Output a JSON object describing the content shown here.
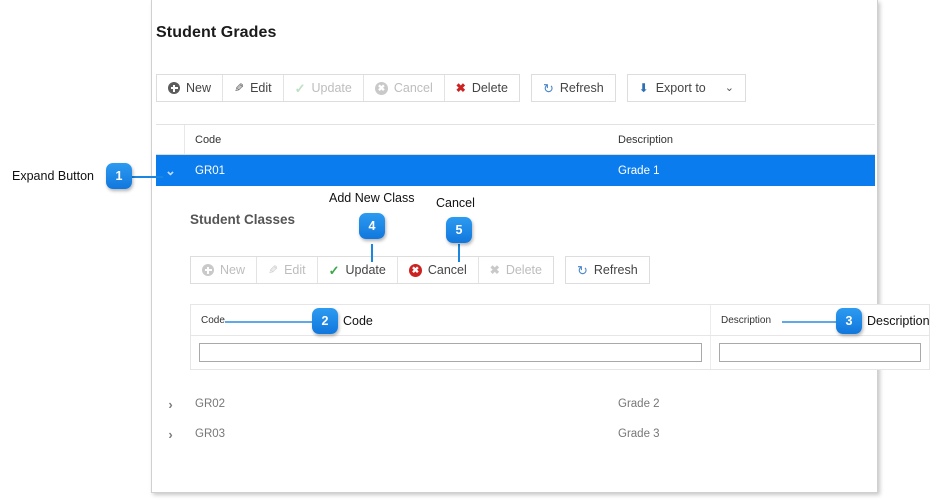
{
  "page": {
    "title": "Student Grades",
    "accent_blue": "#0b7ced",
    "badge_blue": "#1177dd",
    "red": "#cc2222",
    "green": "#3aa84a"
  },
  "main_toolbar": {
    "buttons": [
      {
        "label": "New",
        "icon": "plus-circle-icon",
        "disabled": false
      },
      {
        "label": "Edit",
        "icon": "pencil-icon",
        "disabled": false
      },
      {
        "label": "Update",
        "icon": "check-icon",
        "disabled": true
      },
      {
        "label": "Cancel",
        "icon": "cancel-circle-icon",
        "disabled": true
      },
      {
        "label": "Delete",
        "icon": "x-icon",
        "disabled": false
      }
    ],
    "refresh": {
      "label": "Refresh",
      "icon": "refresh-icon"
    },
    "export": {
      "label": "Export to",
      "icon": "download-icon",
      "caret": "chevron-down-icon"
    }
  },
  "grid": {
    "columns": [
      "Code",
      "Description"
    ],
    "rows": [
      {
        "code": "GR01",
        "description": "Grade 1",
        "expanded": true,
        "chevron": "chevron-down-icon"
      },
      {
        "code": "GR02",
        "description": "Grade 2",
        "expanded": false,
        "chevron": "chevron-right-icon"
      },
      {
        "code": "GR03",
        "description": "Grade 3",
        "expanded": false,
        "chevron": "chevron-right-icon"
      }
    ]
  },
  "detail": {
    "title": "Student Classes",
    "toolbar": {
      "buttons": [
        {
          "label": "New",
          "icon": "plus-circle-icon",
          "disabled": true
        },
        {
          "label": "Edit",
          "icon": "pencil-icon",
          "disabled": true
        },
        {
          "label": "Update",
          "icon": "check-icon",
          "disabled": false
        },
        {
          "label": "Cancel",
          "icon": "cancel-circle-icon",
          "disabled": false
        },
        {
          "label": "Delete",
          "icon": "x-icon",
          "disabled": true
        }
      ],
      "refresh": {
        "label": "Refresh",
        "icon": "refresh-icon"
      }
    },
    "columns": [
      "Code",
      "Description"
    ],
    "edit_row": {
      "code_value": "",
      "description_value": ""
    }
  },
  "annotations": [
    {
      "num": "1",
      "label": "Expand Button"
    },
    {
      "num": "2",
      "label": "Code"
    },
    {
      "num": "3",
      "label": "Description"
    },
    {
      "num": "4",
      "label": "Add New Class"
    },
    {
      "num": "5",
      "label": "Cancel"
    }
  ]
}
